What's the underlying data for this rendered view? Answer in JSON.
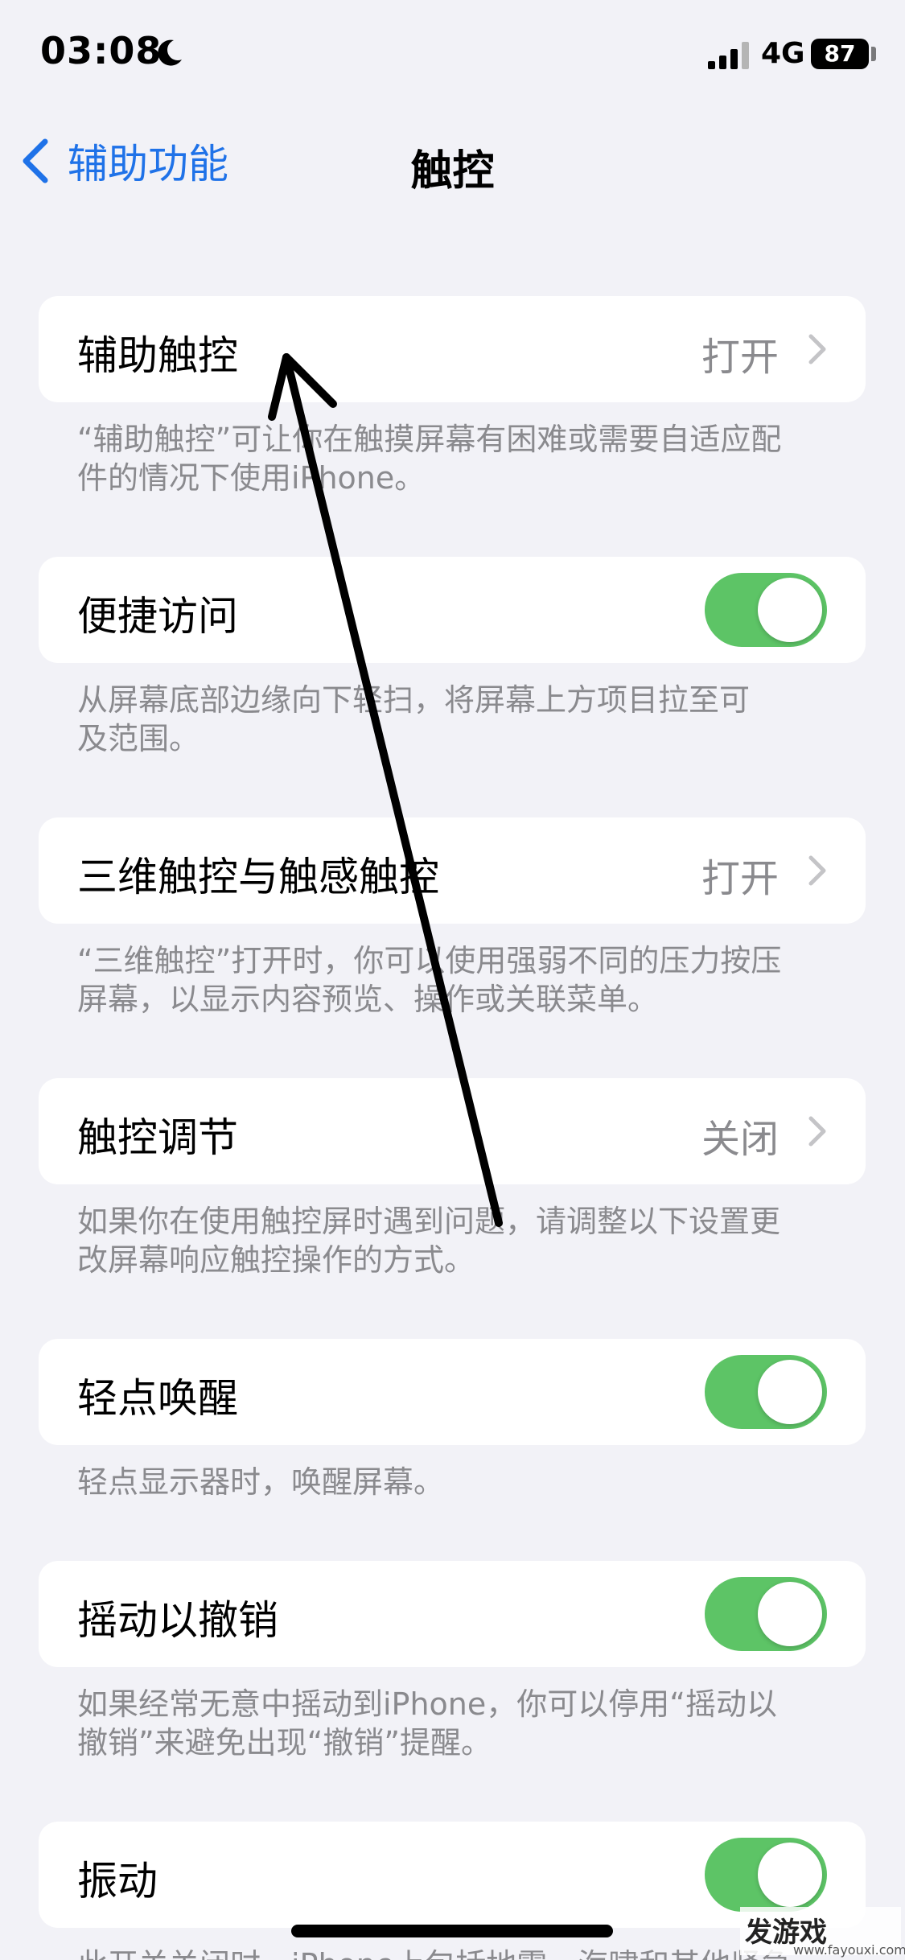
{
  "status_bar": {
    "time": "03:08",
    "network": "4G",
    "battery": "87",
    "icons": [
      "moon-icon",
      "signal-icon",
      "battery-icon"
    ]
  },
  "nav": {
    "back_label": "辅助功能",
    "title": "触控"
  },
  "rows": [
    {
      "label": "辅助触控",
      "value": "打开",
      "type": "disclosure",
      "footnote": [
        "“辅助触控”可让你在触摸屏幕有困难或需要自适应配",
        "件的情况下使用iPhone。"
      ]
    },
    {
      "label": "便捷访问",
      "type": "toggle",
      "on": true,
      "footnote": [
        "从屏幕底部边缘向下轻扫，将屏幕上方项目拉至可",
        "及范围。"
      ]
    },
    {
      "label": "三维触控与触感触控",
      "value": "打开",
      "type": "disclosure",
      "footnote": [
        "“三维触控”打开时，你可以使用强弱不同的压力按压",
        "屏幕，以显示内容预览、操作或关联菜单。"
      ]
    },
    {
      "label": "触控调节",
      "value": "关闭",
      "type": "disclosure",
      "footnote": [
        "如果你在使用触控屏时遇到问题，请调整以下设置更",
        "改屏幕响应触控操作的方式。"
      ]
    },
    {
      "label": "轻点唤醒",
      "type": "toggle",
      "on": true,
      "footnote": [
        "轻点显示器时，唤醒屏幕。"
      ]
    },
    {
      "label": "摇动以撤销",
      "type": "toggle",
      "on": true,
      "footnote": [
        "如果经常无意中摇动到iPhone，你可以停用“摇动以",
        "撤销”来避免出现“撤销”提醒。"
      ]
    },
    {
      "label": "振动",
      "type": "toggle",
      "on": true,
      "footnote": [
        "此开关关闭时，iPhone上包括地震、海啸和其他紧急"
      ]
    }
  ],
  "watermark": {
    "main": "发游戏",
    "sub": "www.fayouxi.com"
  },
  "colors": {
    "accent": "#1f72e8",
    "toggle_on": "#5dc466",
    "background": "#f2f2f7",
    "secondary_text": "#8a8a8e"
  }
}
